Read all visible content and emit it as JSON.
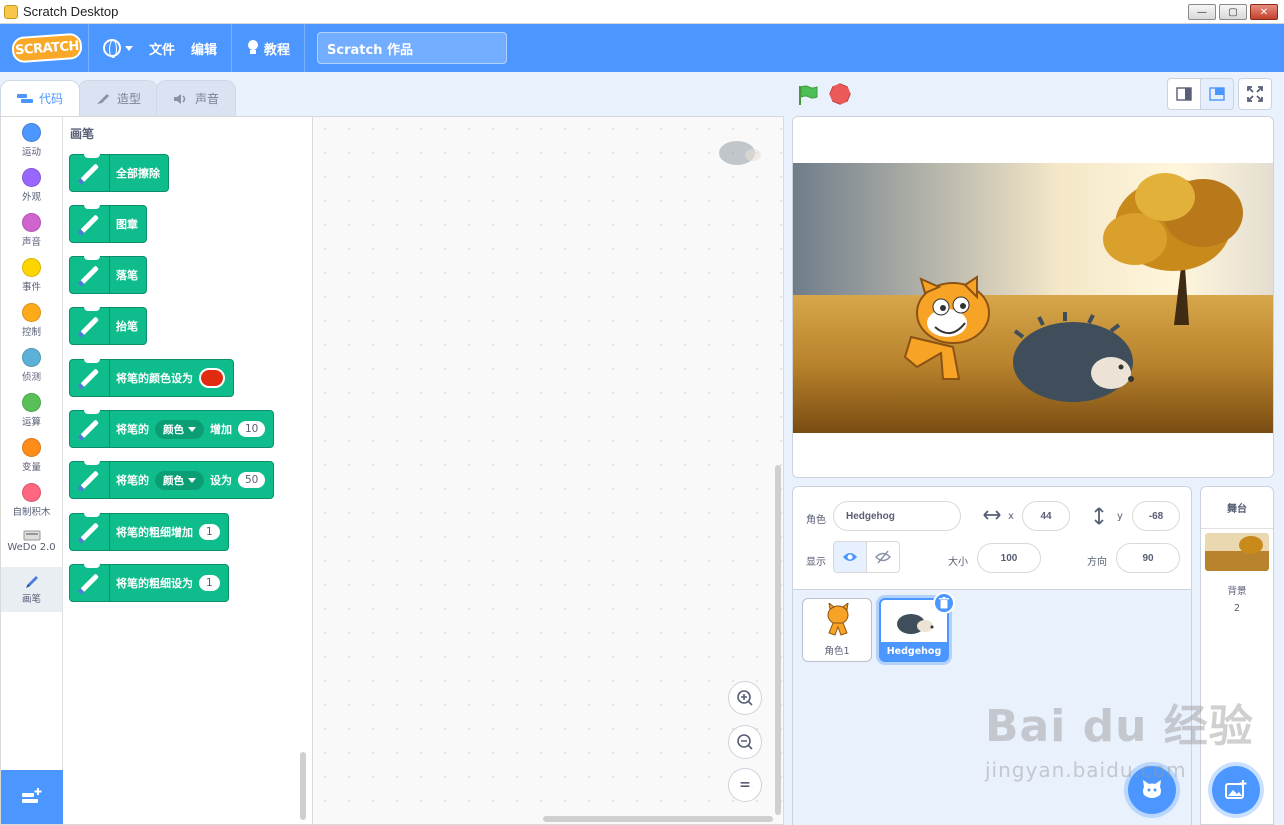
{
  "window": {
    "title": "Scratch Desktop"
  },
  "menubar": {
    "logo": "SCRATCH",
    "file": "文件",
    "edit": "编辑",
    "tutorials": "教程",
    "project_title": "Scratch 作品"
  },
  "tabs": [
    {
      "label": "代码"
    },
    {
      "label": "造型"
    },
    {
      "label": "声音"
    }
  ],
  "categories": [
    {
      "label": "运动",
      "color": "#4c97ff"
    },
    {
      "label": "外观",
      "color": "#9966ff"
    },
    {
      "label": "声音",
      "color": "#cf63cf"
    },
    {
      "label": "事件",
      "color": "#ffd500"
    },
    {
      "label": "控制",
      "color": "#ffab19"
    },
    {
      "label": "侦测",
      "color": "#5cb1d6"
    },
    {
      "label": "运算",
      "color": "#59c059"
    },
    {
      "label": "变量",
      "color": "#ff8c1a"
    },
    {
      "label": "自制积木",
      "color": "#ff6680"
    },
    {
      "label": "WeDo 2.0"
    },
    {
      "label": "画笔"
    }
  ],
  "palette": {
    "heading": "画笔",
    "blocks": {
      "erase_all": "全部擦除",
      "stamp": "图章",
      "pen_down": "落笔",
      "pen_up": "抬笔",
      "set_color_to": "将笔的颜色设为",
      "change_param_prefix": "将笔的",
      "change_param_dd": "颜色",
      "change_param_mid": "增加",
      "change_param_value": "10",
      "set_param_prefix": "将笔的",
      "set_param_dd": "颜色",
      "set_param_mid": "设为",
      "set_param_value": "50",
      "change_size": "将笔的粗细增加",
      "change_size_value": "1",
      "set_size": "将笔的粗细设为",
      "set_size_value": "1"
    },
    "pen_color": "#e02b10"
  },
  "code_area": {
    "zoom_in": "+",
    "zoom_out": "−",
    "zoom_reset": "="
  },
  "sprite_info": {
    "sprite_label": "角色",
    "sprite_name": "Hedgehog",
    "x_label": "x",
    "x_value": "44",
    "y_label": "y",
    "y_value": "-68",
    "show_label": "显示",
    "size_label": "大小",
    "size_value": "100",
    "direction_label": "方向",
    "direction_value": "90"
  },
  "sprites": [
    {
      "name": "角色1"
    },
    {
      "name": "Hedgehog"
    }
  ],
  "stage_target": {
    "header": "舞台",
    "backdrops_label": "背景",
    "backdrops_count": "2"
  },
  "watermark": {
    "brand": "Bai du 经验",
    "url": "jingyan.baidu.com"
  },
  "colors": {
    "accent": "#4c97ff",
    "pen_block": "#0fbd8c"
  }
}
